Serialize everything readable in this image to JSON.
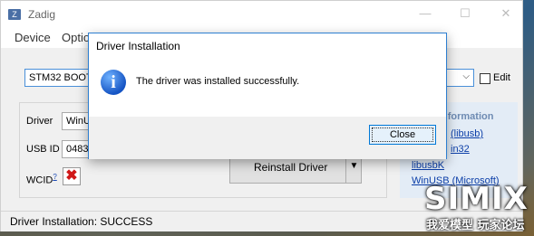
{
  "app": {
    "title": "Zadig",
    "icon_letter": "Z",
    "window_controls": {
      "minimize": "—",
      "maximize": "☐",
      "close": "✕"
    },
    "menu": [
      "Device",
      "Optio"
    ]
  },
  "device": {
    "selected": "STM32  BOOT",
    "edit_label": "Edit"
  },
  "driver_panel": {
    "driver_label": "Driver",
    "driver_value": "WinUS",
    "usb_id_label": "USB ID",
    "usb_id_value": "0483",
    "wcid_label": "WCID",
    "wcid_help": "?",
    "wcid_mark": "✖",
    "reinstall_label": "Reinstall Driver",
    "split_arrow": "▼"
  },
  "info_panel": {
    "heading": "nformation",
    "links": [
      "(libusb)",
      "in32",
      "libusbK",
      "WinUSB (Microsoft)"
    ]
  },
  "status": {
    "text": "Driver Installation: SUCCESS"
  },
  "dialog": {
    "title": "Driver Installation",
    "icon_glyph": "i",
    "message": "The driver was installed successfully.",
    "close_label": "Close"
  },
  "watermark": {
    "big": "SIMIX",
    "small": "我爱模型 玩家论坛"
  },
  "colors": {
    "dialog_border": "#2e7fd1",
    "link": "#0b3ea8",
    "info_icon": "#1655c4",
    "wcid_x": "#d01818"
  }
}
